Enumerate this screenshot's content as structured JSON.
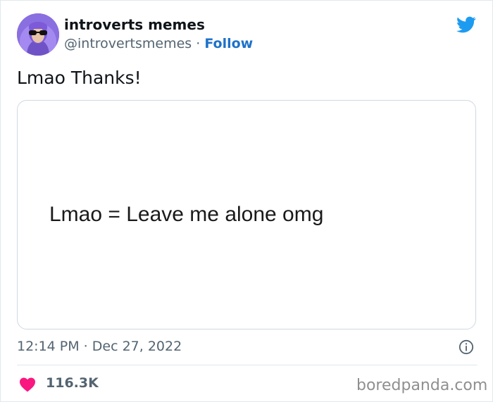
{
  "author": {
    "name": "introverts memes",
    "handle": "@introvertsmemes",
    "separator": "·",
    "follow_label": "Follow"
  },
  "tweet": {
    "text": "Lmao Thanks!",
    "media_text": "Lmao = Leave me alone omg",
    "timestamp": "12:14 PM · Dec 27, 2022",
    "like_count": "116.3K"
  },
  "icons": {
    "brand": "twitter-bird-icon",
    "info": "info-icon",
    "like": "heart-icon"
  },
  "watermark": "boredpanda.com",
  "colors": {
    "follow": "#1d72c9",
    "twitter_blue": "#1d9bf0",
    "heart": "#f91880",
    "secondary_text": "#536471"
  }
}
